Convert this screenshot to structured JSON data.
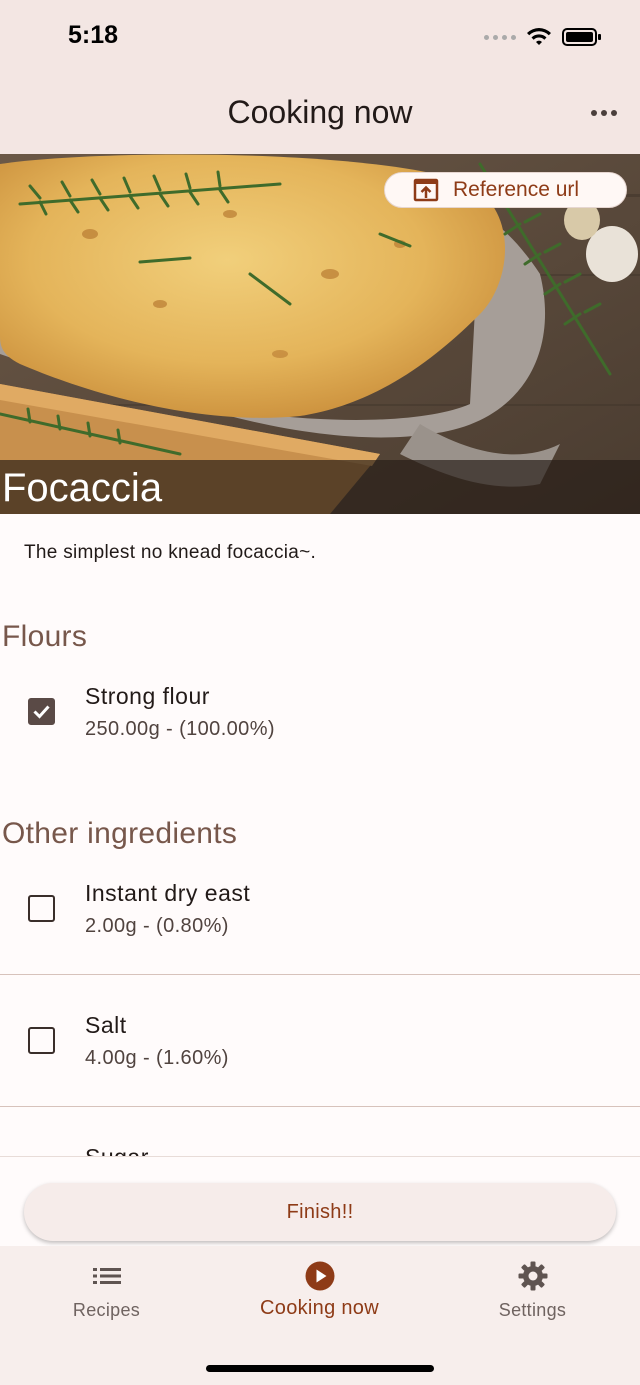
{
  "status_bar": {
    "time": "5:18"
  },
  "app_bar": {
    "title": "Cooking now"
  },
  "hero": {
    "reference_label": "Reference url",
    "recipe_title": "Focaccia"
  },
  "description": "The simplest no knead focaccia~.",
  "sections": [
    {
      "title": "Flours",
      "items": [
        {
          "name": "Strong flour",
          "amount": "250.00g - (100.00%)",
          "checked": true
        }
      ]
    },
    {
      "title": "Other ingredients",
      "items": [
        {
          "name": "Instant dry east",
          "amount": "2.00g - (0.80%)",
          "checked": false
        },
        {
          "name": "Salt",
          "amount": "4.00g - (1.60%)",
          "checked": false
        },
        {
          "name": "Sugar",
          "amount": "",
          "checked": false
        }
      ]
    }
  ],
  "finish_label": "Finish!!",
  "bottom_nav": {
    "items": [
      {
        "label": "Recipes",
        "icon": "list-icon"
      },
      {
        "label": "Cooking now",
        "icon": "play-circle-icon"
      },
      {
        "label": "Settings",
        "icon": "gear-icon"
      }
    ],
    "active": "Cooking now"
  },
  "colors": {
    "accent": "#8e3b17",
    "section_title": "#77574b",
    "app_bar": "#f3e6e3",
    "background": "#fffbfb"
  }
}
